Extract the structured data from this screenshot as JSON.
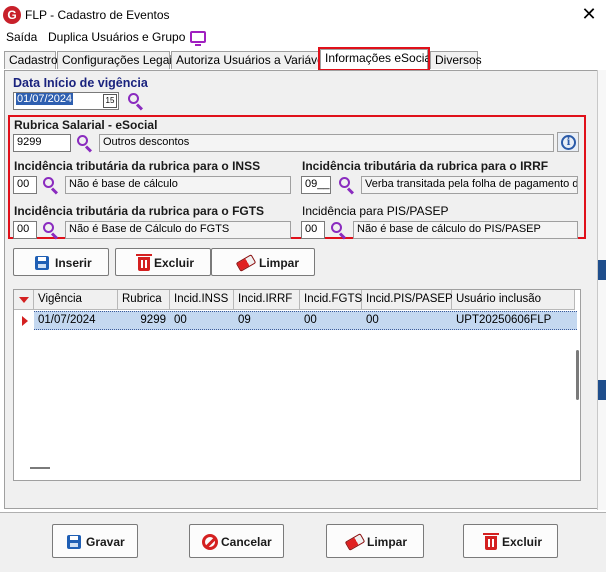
{
  "window": {
    "title": "FLP - Cadastro de Eventos",
    "logo_letter": "G",
    "close_glyph": "✕"
  },
  "menu": {
    "items": [
      "Saída",
      "Duplica Usuários e Grupo"
    ]
  },
  "tabs": [
    {
      "label": "Cadastro"
    },
    {
      "label": "Configurações Legais"
    },
    {
      "label": "Autoriza Usuários a Variáveis"
    },
    {
      "label": "Informações eSocial",
      "active": true
    },
    {
      "label": "Diversos"
    }
  ],
  "vigencia": {
    "label": "Data Início de vigência",
    "value": "01/07/2024",
    "calendar_glyph": "15"
  },
  "rubrica": {
    "label": "Rubrica Salarial - eSocial",
    "code": "9299",
    "desc": "Outros descontos",
    "info_glyph": "i"
  },
  "inss": {
    "label": "Incidência tributária da rubrica para o INSS",
    "code": "00",
    "desc": "Não é base de cálculo"
  },
  "irrf": {
    "label": "Incidência tributária da rubrica para o IRRF",
    "code": "09__",
    "desc": "Verba transitada pela folha de pagamento de"
  },
  "fgts": {
    "label": "Incidência tributária da rubrica para o FGTS",
    "code": "00",
    "desc": "Não é Base de Cálculo do FGTS"
  },
  "pis": {
    "label": "Incidência para PIS/PASEP",
    "code": "00",
    "desc": "Não é base de cálculo do PIS/PASEP"
  },
  "actions": {
    "inserir": "Inserir",
    "excluir": "Excluir",
    "limpar": "Limpar"
  },
  "grid": {
    "columns": [
      "Vigência",
      "Rubrica",
      "Incid.INSS",
      "Incid.IRRF",
      "Incid.FGTS",
      "Incid.PIS/PASEP",
      "Usuário inclusão"
    ],
    "rows": [
      [
        "01/07/2024",
        "9299",
        "00",
        "09",
        "00",
        "00",
        "UPT20250606FLP"
      ]
    ]
  },
  "footer": {
    "gravar": "Gravar",
    "cancelar": "Cancelar",
    "limpar": "Limpar",
    "excluir": "Excluir"
  },
  "colors": {
    "highlight": "#e0101a",
    "label_blue": "#1a237e",
    "search_icon": "#8a2bbf",
    "selection": "#c4d8f0"
  }
}
